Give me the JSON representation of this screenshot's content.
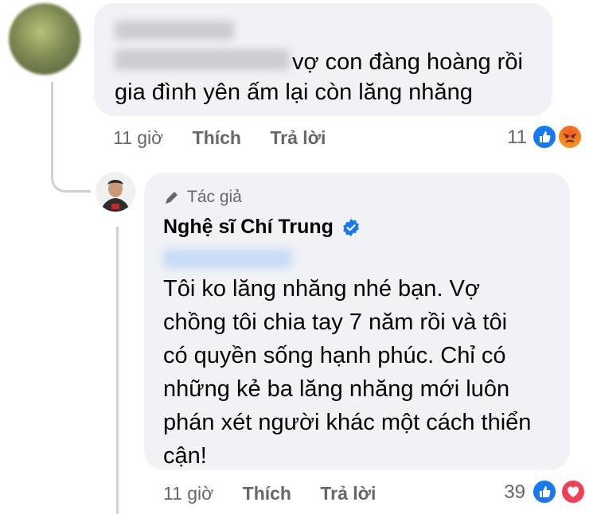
{
  "comment": {
    "text_line1": "vợ con đàng hoàng rồi",
    "text_line2": "gia đình yên ấm lại còn lăng nhăng",
    "time": "11 giờ",
    "like_label": "Thích",
    "reply_label": "Trả lời",
    "reaction_count": "11",
    "reactions": [
      "like-icon",
      "angry-icon"
    ]
  },
  "reply": {
    "author_badge": "Tác giả",
    "author_name": "Nghệ sĩ Chí Trung",
    "text_lines": [
      "Tôi ko lăng nhăng nhé bạn. Vợ",
      "chồng tôi chia tay 7 năm rồi và tôi",
      "có quyền sống hạnh phúc. Chỉ có",
      "những kẻ ba lăng nhăng mới luôn",
      "phán xét người khác một cách thiển",
      "cận!"
    ],
    "time": "11 giờ",
    "like_label": "Thích",
    "reply_label": "Trả lời",
    "reaction_count": "39",
    "reactions": [
      "like-icon",
      "love-icon"
    ]
  },
  "colors": {
    "bubble": "#f0f2f5",
    "meta_text": "#65676b",
    "like_blue": "#1877f2",
    "love_red": "#f33e58",
    "angry_orange": "#e9710f",
    "verified_blue": "#1877f2"
  }
}
